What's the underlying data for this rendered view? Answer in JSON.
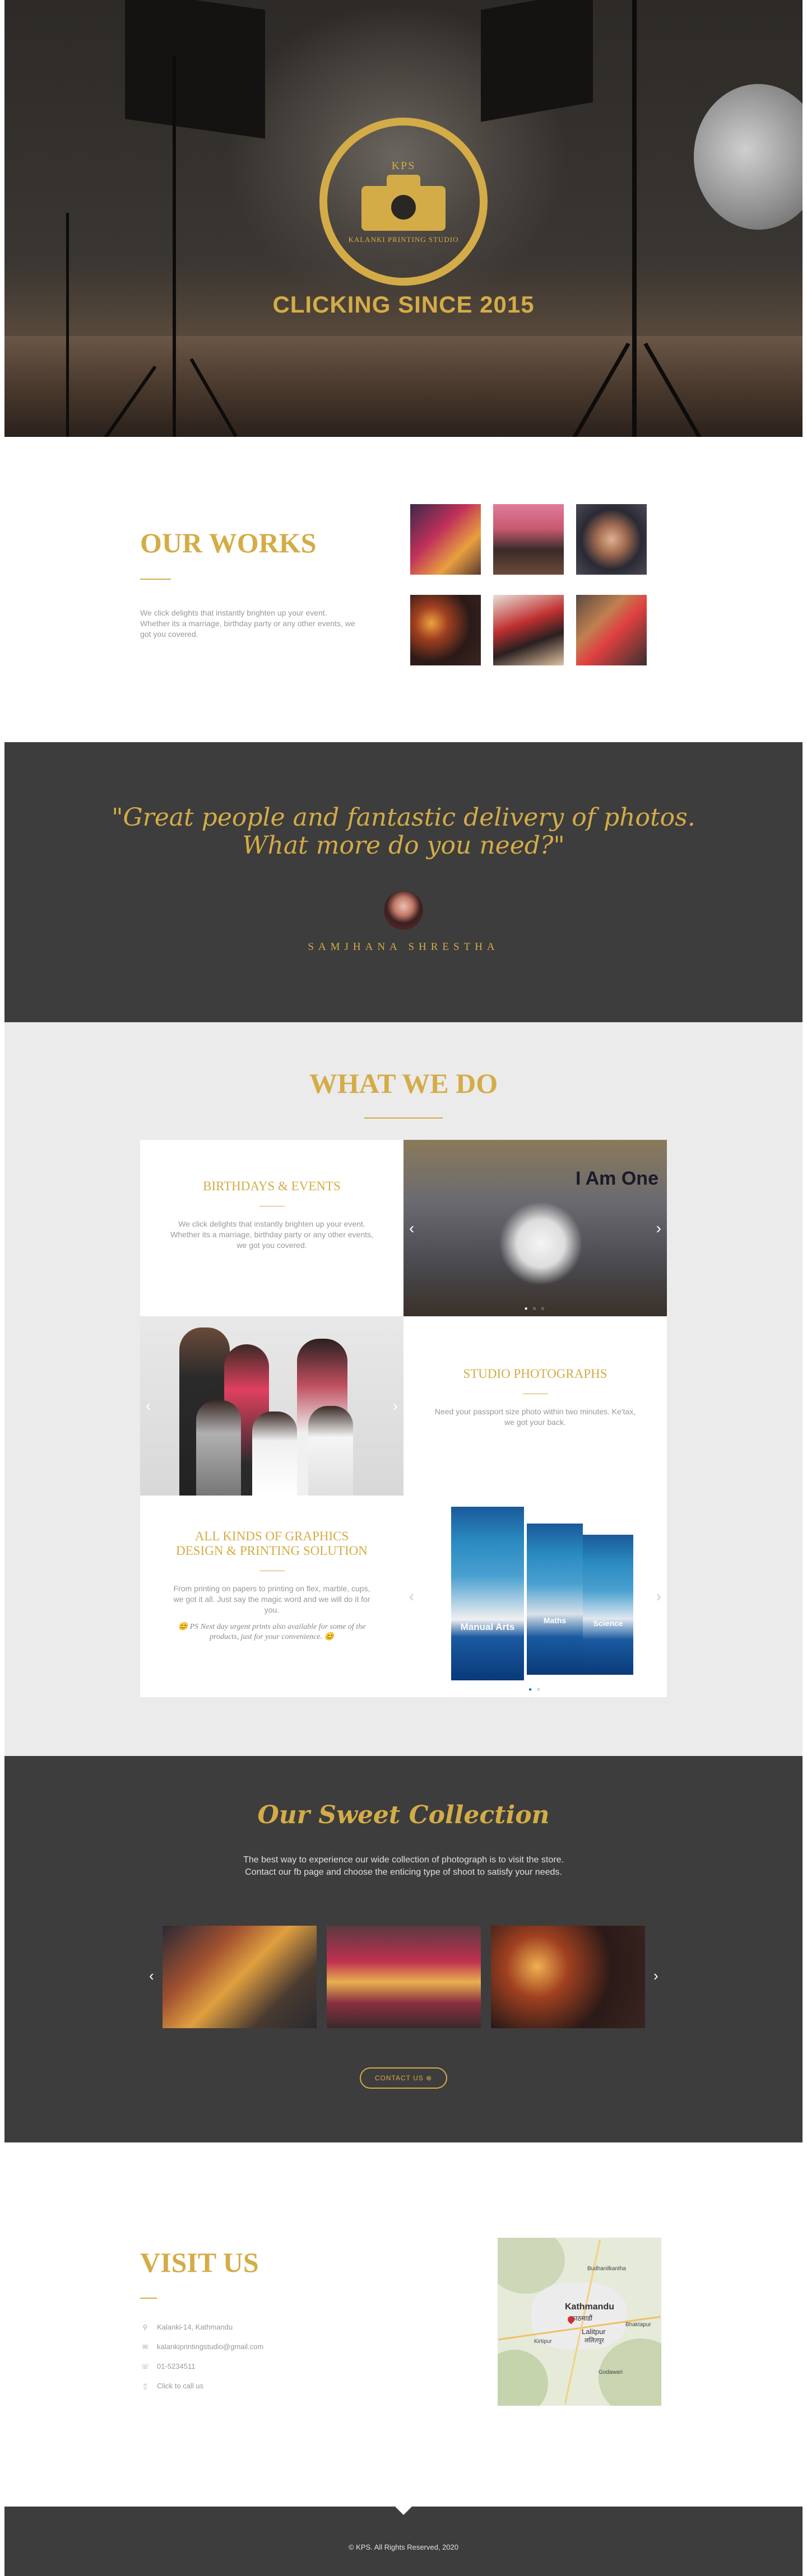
{
  "hero": {
    "logo_kps": "KPS",
    "logo_name": "KALANKI PRINTING STUDIO",
    "tagline": "CLICKING SINCE 2015"
  },
  "works": {
    "title": "OUR WORKS",
    "description": "We click delights that instantly brighten up your event. Whether its a marriage, birthday party or any other events, we got you covered."
  },
  "quote": {
    "text_line1": "\"Great people and fantastic delivery of photos.",
    "text_line2": "What more do you need?\"",
    "author": "SAMJHANA SHRESTHA"
  },
  "what_we_do": {
    "title": "WHAT WE DO",
    "birthdays": {
      "title": "BIRTHDAYS & EVENTS",
      "description": "We click delights that instantly brighten up your event. Whether its a marriage, birthday party or any other events, we got you covered."
    },
    "studio": {
      "title": "STUDIO PHOTOGRAPHS",
      "description": "Need your passport size photo within two minutes. Ke'tax, we got your back."
    },
    "graphics": {
      "title_line1": "ALL KINDS OF GRAPHICS",
      "title_line2": "DESIGN & PRINTING SOLUTION",
      "description": "From printing on papers to printing on flex, marble, cups, we got it all. Just say the magic word and we will do it for you.",
      "note": "😊 PS Next day urgent prints also available for some of the products, just for your convenience. 😊"
    },
    "banner_text": "I Am One",
    "banners": [
      "Manual Arts",
      "Maths",
      "Science"
    ]
  },
  "collection": {
    "title": "Our Sweet Collection",
    "description_line1": "The best way to experience our wide collection of photograph is to visit the store.",
    "description_line2": "Contact our fb page and choose the enticing type of shoot to satisfy your needs.",
    "contact_button": "CONTACT US"
  },
  "visit": {
    "title": "VISIT US",
    "address": "Kalanki-14, Kathmandu",
    "email": "kalankiprintingstudio@gmail.com",
    "phone": "01-5234511",
    "call": "Click to call us",
    "map_labels": {
      "city": "Kathmandu",
      "city_native": "काठमाडौं",
      "lalitpur": "Lalitpur",
      "lalitpur_native": "ललितपुर",
      "bhaktapur": "Bhaktapur",
      "budhanilkantha": "Budhanilkantha",
      "kirtipur": "Kirtipur",
      "godawari": "Godawari"
    }
  },
  "footer": {
    "text": "© KPS. All Rights Reserved, 2020"
  },
  "colors": {
    "gold": "#d4ac47",
    "dark": "#3d3d3d",
    "light_gray": "#ebebeb"
  }
}
